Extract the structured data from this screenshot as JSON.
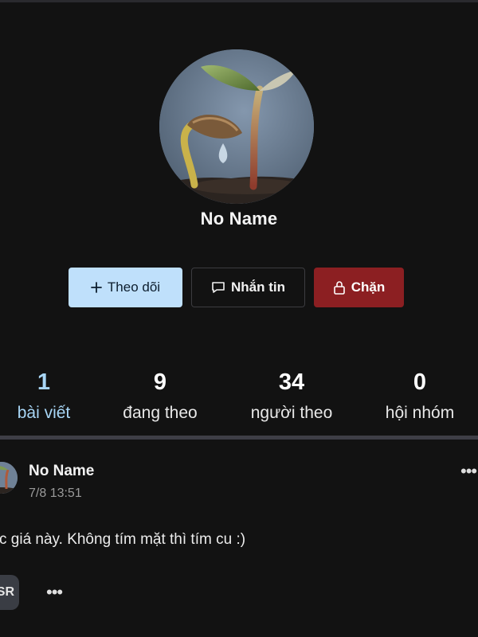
{
  "profile": {
    "name": "No Name"
  },
  "actions": {
    "follow": {
      "label": "Theo dõi",
      "icon": "plus-icon",
      "color": "#bfe0fb"
    },
    "message": {
      "label": "Nhắn tin",
      "icon": "chat-bubble-icon"
    },
    "block": {
      "label": "Chặn",
      "icon": "lock-icon",
      "color": "#8c1f22"
    }
  },
  "stats": [
    {
      "value": "1",
      "label": "bài viết",
      "active": true
    },
    {
      "value": "9",
      "label": "đang theo",
      "active": false
    },
    {
      "value": "34",
      "label": "người theo",
      "active": false
    },
    {
      "value": "0",
      "label": "hội nhóm",
      "active": false
    }
  ],
  "post": {
    "author": "No Name",
    "time": "7/8 13:51",
    "text": "c giá này. Không tím mặt thì tím cu :)",
    "more_label": "•••",
    "reaction_chip": "SR",
    "reaction_more": "•••"
  },
  "colors": {
    "background": "#121212",
    "accent": "#a8d6f6",
    "divider": "#3e3e46"
  }
}
